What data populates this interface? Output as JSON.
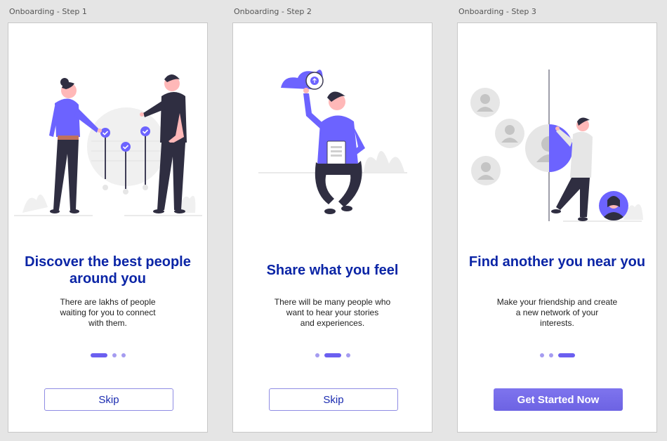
{
  "colors": {
    "accent": "#6c63ff",
    "title": "#0b25a6",
    "dark": "#2f2e41",
    "skin": "#ffb8b8",
    "grey": "#e6e6e6"
  },
  "frames": [
    {
      "label": "Onboarding - Step 1",
      "title": "Discover the best people around you",
      "description": "There are lakhs of people\nwaiting for you to connect\nwith them.",
      "active_dot": 0,
      "button": {
        "label": "Skip",
        "style": "outline"
      }
    },
    {
      "label": "Onboarding - Step 2",
      "title": "Share what you feel",
      "description": "There will be many people who\nwant to hear your stories\nand experiences.",
      "active_dot": 1,
      "button": {
        "label": "Skip",
        "style": "outline"
      }
    },
    {
      "label": "Onboarding - Step 3",
      "title": "Find another you near you",
      "description": "Make your friendship and create\na new network of your\ninterests.",
      "active_dot": 2,
      "button": {
        "label": "Get Started Now",
        "style": "primary"
      }
    }
  ]
}
